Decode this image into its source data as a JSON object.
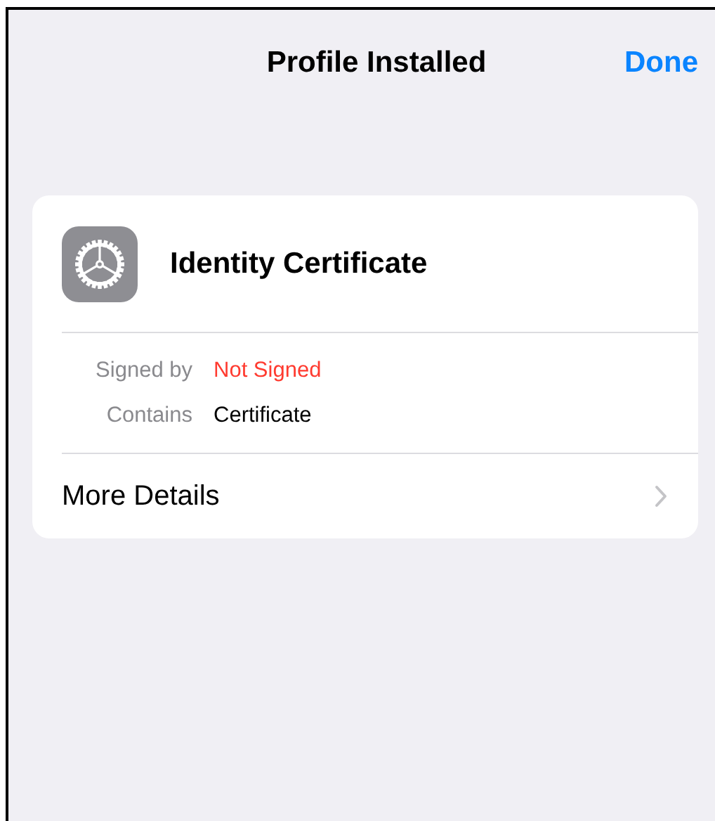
{
  "nav": {
    "title": "Profile Installed",
    "action": "Done"
  },
  "profile": {
    "name": "Identity Certificate",
    "details": [
      {
        "label": "Signed by",
        "value": "Not Signed",
        "color": "#ff3b30"
      },
      {
        "label": "Contains",
        "value": "Certificate",
        "color": "#000000"
      }
    ],
    "more": "More Details"
  }
}
